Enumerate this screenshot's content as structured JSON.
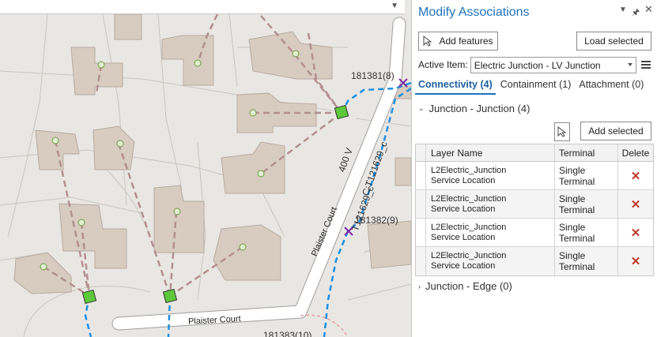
{
  "map": {
    "labels": {
      "fid1": "181381(8)",
      "fid2": "181382(9)",
      "fid3": "181383(10)",
      "voltage": "400 V",
      "conductor": "C:T121629_c",
      "conductor2": "T121629_c",
      "road1": "Plaister Court",
      "road2": "Plaister Court"
    }
  },
  "pane": {
    "title": "Modify Associations",
    "add_features_label": "Add features",
    "load_selected_label": "Load selected",
    "active_item_label": "Active Item:",
    "active_item_value": "Electric Junction - LV Junction",
    "tabs": [
      {
        "label": "Connectivity (4)"
      },
      {
        "label": "Containment (1)"
      },
      {
        "label": "Attachment (0)"
      }
    ],
    "section_junction": "Junction - Junction (4)",
    "section_edge": "Junction - Edge (0)",
    "add_selected_label": "Add selected",
    "columns": {
      "layer": "Layer Name",
      "terminal": "Terminal",
      "delete": "Delete"
    },
    "rows": [
      {
        "line1": "L2Electric_Junction",
        "line2": "Service Location",
        "terminal": "Single Terminal"
      },
      {
        "line1": "L2Electric_Junction",
        "line2": "Service Location",
        "terminal": "Single Terminal"
      },
      {
        "line1": "L2Electric_Junction",
        "line2": "Service Location",
        "terminal": "Single Terminal"
      },
      {
        "line1": "L2Electric_Junction",
        "line2": "Service Location",
        "terminal": "Single Terminal"
      }
    ]
  },
  "colors": {
    "accent": "#1e73be",
    "building": "#d8ccc0",
    "road": "#ffffff",
    "service_line": "#b58f8f",
    "primary_line": "#1e8fe0",
    "delete": "#c0392b"
  }
}
